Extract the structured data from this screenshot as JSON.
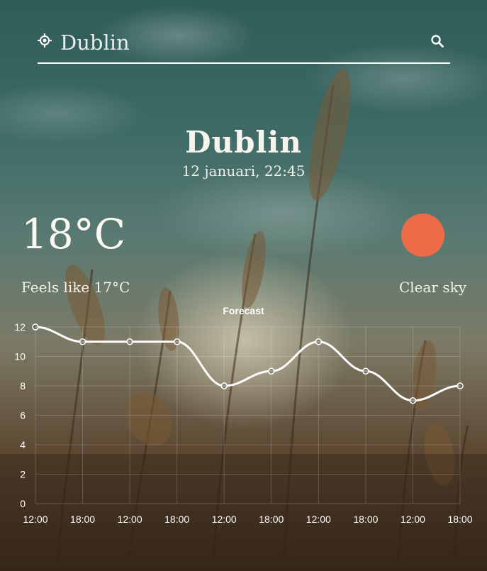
{
  "search": {
    "value": "Dublin",
    "placeholder": "Dublin"
  },
  "location": {
    "city": "Dublin",
    "datetime": "12 januari, 22:45"
  },
  "current": {
    "temperature": "18°C",
    "feels_like": "Feels like 17°C",
    "condition": "Clear sky",
    "condition_icon": "sun-icon",
    "icon_color": "#ee6b4a"
  },
  "chart_data": {
    "type": "line",
    "title": "Forecast",
    "x": [
      "12:00",
      "18:00",
      "12:00",
      "18:00",
      "12:00",
      "18:00",
      "12:00",
      "18:00",
      "12:00",
      "18:00"
    ],
    "series": [
      {
        "values": [
          12,
          11,
          11,
          11,
          8,
          9,
          11,
          9,
          7,
          8
        ]
      }
    ],
    "ylim": [
      0,
      12
    ],
    "yticks": [
      0,
      2,
      4,
      6,
      8,
      10,
      12
    ],
    "grid": true,
    "line_color": "#ffffff"
  }
}
